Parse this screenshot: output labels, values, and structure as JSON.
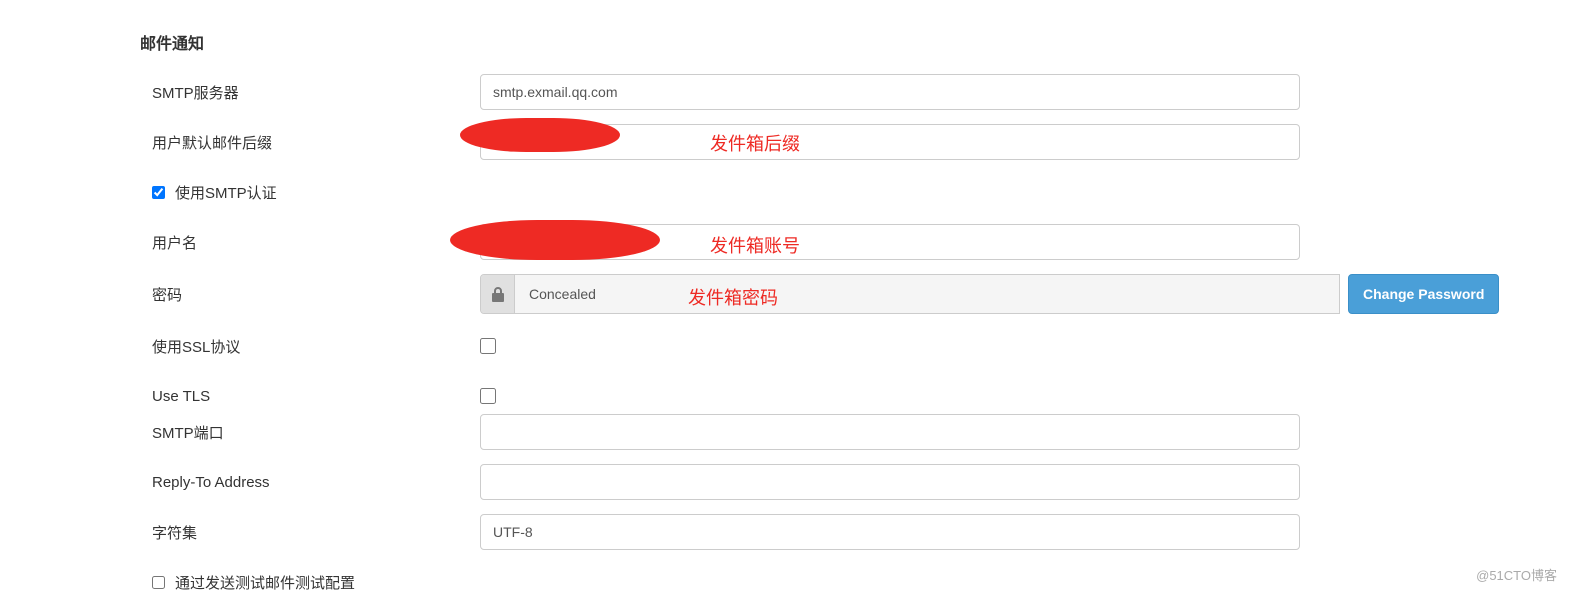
{
  "section": {
    "title": "邮件通知"
  },
  "fields": {
    "smtp_server": {
      "label": "SMTP服务器",
      "value": "smtp.exmail.qq.com"
    },
    "default_suffix": {
      "label": "用户默认邮件后缀",
      "value": ""
    },
    "smtp_auth": {
      "label": "使用SMTP认证"
    },
    "username": {
      "label": "用户名",
      "value": ""
    },
    "password": {
      "label": "密码",
      "concealed": "Concealed",
      "button": "Change Password"
    },
    "use_ssl": {
      "label": "使用SSL协议"
    },
    "use_tls": {
      "label": "Use TLS"
    },
    "smtp_port": {
      "label": "SMTP端口",
      "value": ""
    },
    "reply_to": {
      "label": "Reply-To Address",
      "value": ""
    },
    "charset": {
      "label": "字符集",
      "value": "UTF-8"
    },
    "test_config": {
      "label": "通过发送测试邮件测试配置"
    }
  },
  "annotations": {
    "suffix": "发件箱后缀",
    "account": "发件箱账号",
    "password": "发件箱密码"
  },
  "help_glyph": "?",
  "watermark": "@51CTO博客"
}
